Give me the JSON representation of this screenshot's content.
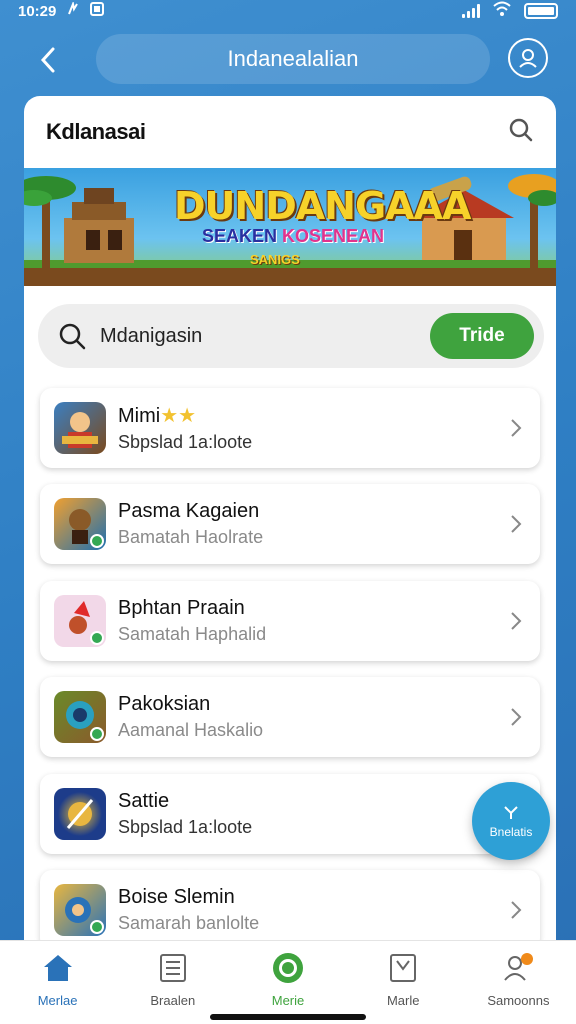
{
  "status_bar": {
    "time": "10:29",
    "wifi_icon": "wifi-icon",
    "battery_icon": "battery-icon"
  },
  "header": {
    "title": "Indanealalian"
  },
  "card": {
    "title": "Kdlanasai"
  },
  "banner": {
    "title": "DUNDANGAAA",
    "sub_left": "SEAKEN",
    "sub_right": "KOSENEAN",
    "tag": "SANIGS"
  },
  "search": {
    "value": "Mdanigasin",
    "button": "Tride"
  },
  "apps": [
    {
      "name": "Mimi",
      "stars": "★★",
      "desc": "Sbpslad 1a:loote",
      "icon_color": "#3b7fc1"
    },
    {
      "name": "Pasma Kagaien",
      "stars": "",
      "desc": "Bamatah Haolrate",
      "icon_color": "#1e6fb0"
    },
    {
      "name": "Bphtan Praain",
      "stars": "",
      "desc": "Samatah Haphalid",
      "icon_color": "#f2d8e8"
    },
    {
      "name": "Pakoksian",
      "stars": "",
      "desc": "Aamanal Haskalio",
      "icon_color": "#8b5a2b"
    },
    {
      "name": "Sattie",
      "stars": "",
      "desc": "Sbpslad 1a:loote",
      "icon_color": "#1d3c8a"
    },
    {
      "name": "Boise Slemin",
      "stars": "",
      "desc": "Samarah banlolte",
      "icon_color": "#e8b640"
    }
  ],
  "fab": {
    "label": "Bnelatis"
  },
  "nav": [
    {
      "label": "Merlae",
      "icon": "home-icon"
    },
    {
      "label": "Braalen",
      "icon": "list-icon"
    },
    {
      "label": "Merie",
      "icon": "circle-icon"
    },
    {
      "label": "Marle",
      "icon": "bag-icon"
    },
    {
      "label": "Samoonns",
      "icon": "people-icon"
    }
  ],
  "colors": {
    "accent_green": "#3fa33e",
    "brand_blue": "#2f7fc4",
    "nav_active": "#2a72b8"
  }
}
